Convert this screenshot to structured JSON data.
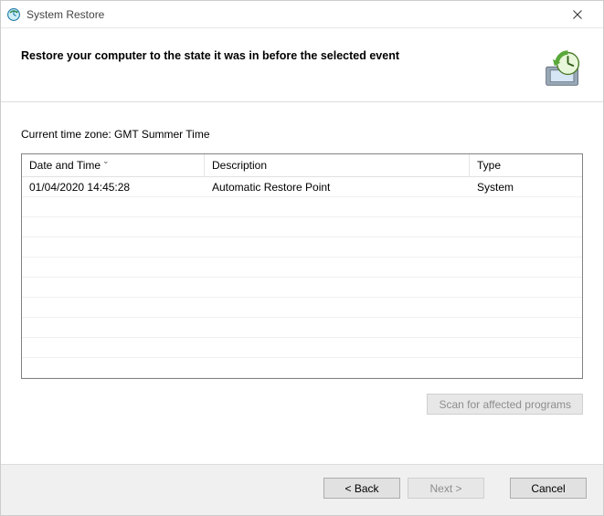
{
  "window": {
    "title": "System Restore",
    "close_label": "Close"
  },
  "header": {
    "heading": "Restore your computer to the state it was in before the selected event"
  },
  "body": {
    "timezone_label": "Current time zone: GMT Summer Time",
    "columns": {
      "datetime": "Date and Time",
      "description": "Description",
      "type": "Type"
    },
    "rows": [
      {
        "datetime": "01/04/2020 14:45:28",
        "description": "Automatic Restore Point",
        "type": "System"
      }
    ],
    "empty_row_count": 9,
    "scan_button": "Scan for affected programs"
  },
  "footer": {
    "back": "< Back",
    "next": "Next >",
    "cancel": "Cancel"
  }
}
